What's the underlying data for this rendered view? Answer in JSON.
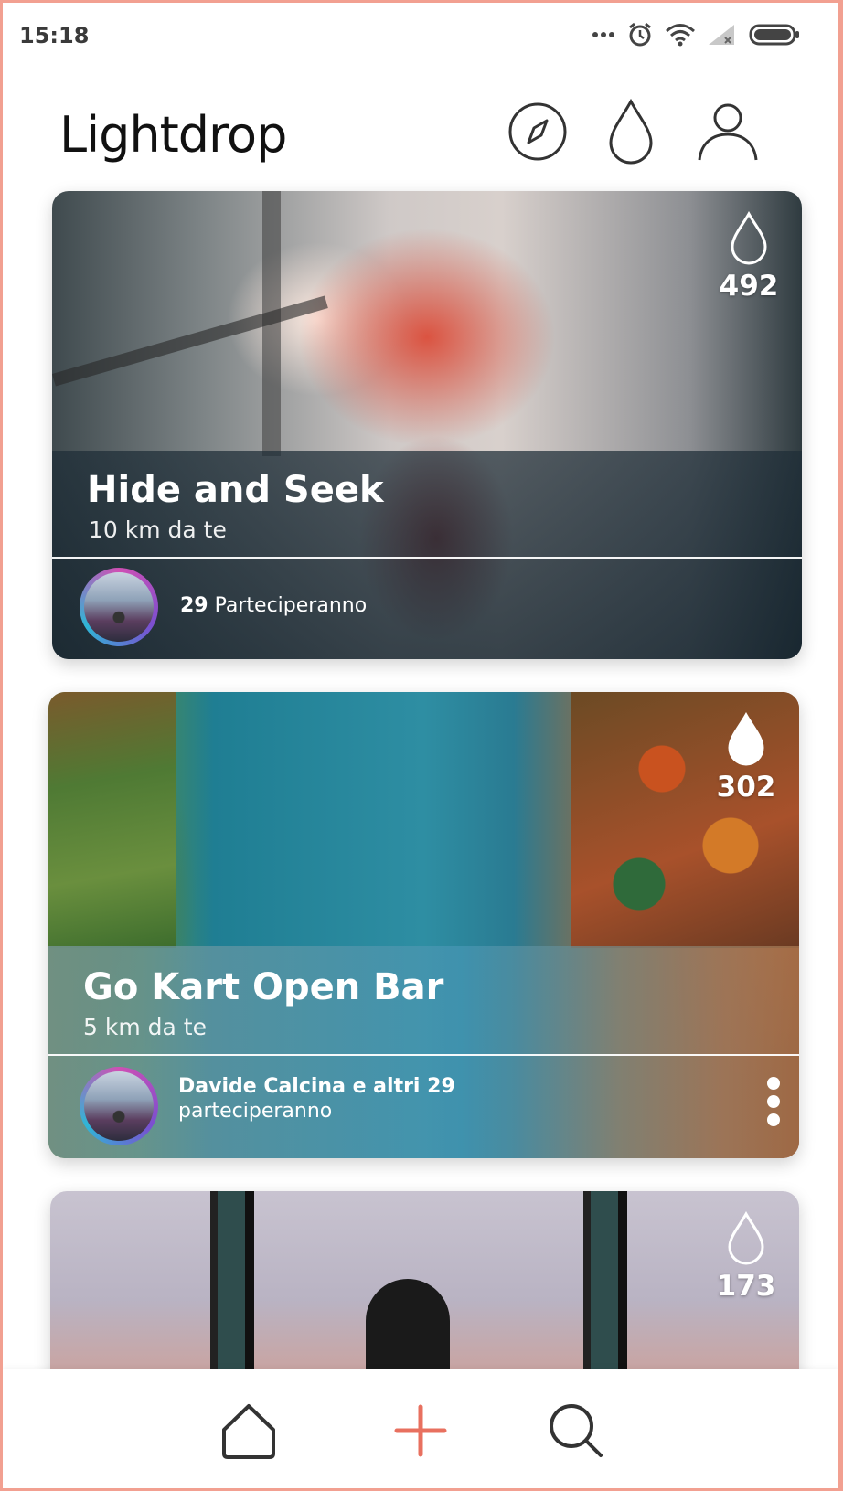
{
  "status_bar": {
    "time": "15:18",
    "icons": [
      "more-dots-icon",
      "alarm-icon",
      "wifi-icon",
      "signal-icon",
      "battery-icon"
    ]
  },
  "header": {
    "app_title": "Lightdrop",
    "actions": [
      "compass-icon",
      "drop-icon",
      "profile-icon"
    ]
  },
  "events": [
    {
      "title": "Hide and Seek",
      "distance": "10 km da te",
      "drops": "492",
      "drop_filled": false,
      "participants_count": "29",
      "participants_label": "Parteciperanno",
      "image": "red-smoke-stairwell"
    },
    {
      "title": "Go Kart Open Bar",
      "distance": "5 km da te",
      "drops": "302",
      "drop_filled": true,
      "participants_name": "Davide Calcina e altri 29",
      "participants_label": "parteciperanno",
      "image": "aerial-lake-autumn-trees"
    },
    {
      "drops": "173",
      "drop_filled": false,
      "image": "silhouette-window-sunset"
    }
  ],
  "bottom_nav": {
    "items": [
      "home-icon",
      "add-icon",
      "search-icon"
    ],
    "accent_color": "#e8705f"
  }
}
